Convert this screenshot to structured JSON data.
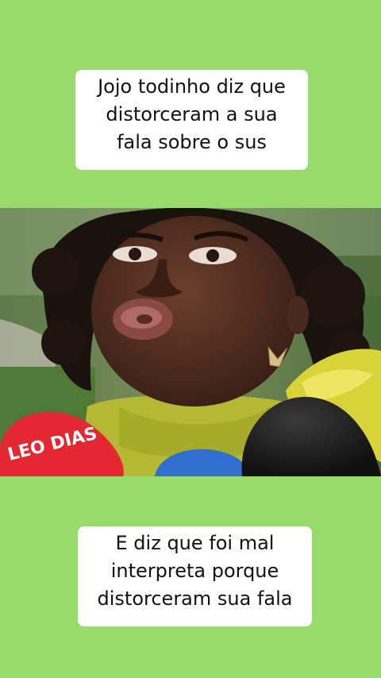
{
  "caption_top": {
    "lines": [
      "Jojo todinho diz que",
      "distorceram a sua",
      "fala sobre o sus"
    ]
  },
  "caption_bottom": {
    "lines": [
      "E diz que foi mal",
      "interpreta porque",
      "distorceram sua fala"
    ]
  },
  "video": {
    "microphone_label": "LEO DIAS"
  },
  "colors": {
    "background": "#97dc6a",
    "caption_bg": "#ffffff",
    "caption_text": "#111111"
  }
}
